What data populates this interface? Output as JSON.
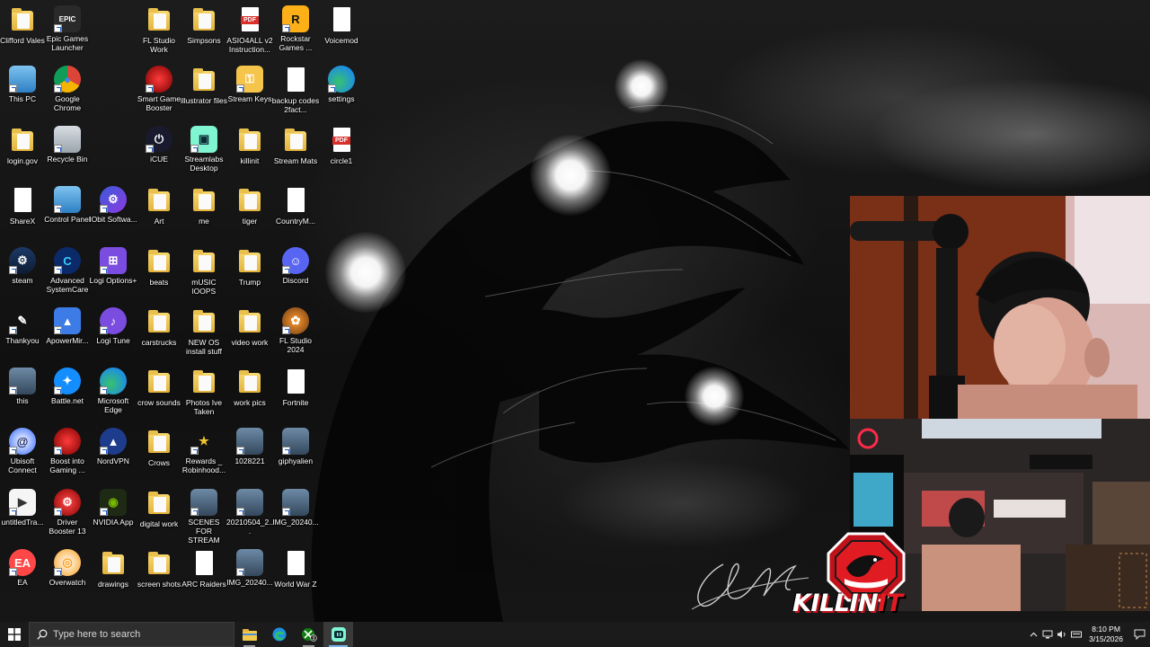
{
  "desktop": {
    "icons": [
      {
        "label": "Clifford Vales",
        "icon": "user-folder-icon"
      },
      {
        "label": "Epic Games Launcher",
        "icon": "epic-games-icon"
      },
      {
        "label": "FL Studio Work",
        "icon": "folder-icon"
      },
      {
        "label": "Simpsons",
        "icon": "folder-icon"
      },
      {
        "label": "ASIO4ALL v2 Instruction...",
        "icon": "pdf-icon"
      },
      {
        "label": "Rockstar Games ...",
        "icon": "rockstar-icon"
      },
      {
        "label": "Voicemod",
        "icon": "file-icon"
      },
      {
        "label": "This PC",
        "icon": "computer-icon"
      },
      {
        "label": "Google Chrome",
        "icon": "chrome-icon"
      },
      {
        "label": "Smart Game Booster",
        "icon": "game-booster-icon"
      },
      {
        "label": "illustrator files",
        "icon": "folder-icon"
      },
      {
        "label": "Stream Keys",
        "icon": "key-icon"
      },
      {
        "label": "backup codes 2fact...",
        "icon": "file-icon"
      },
      {
        "label": "settings",
        "icon": "edge-icon"
      },
      {
        "label": "login.gov",
        "icon": "folder-icon"
      },
      {
        "label": "Recycle Bin",
        "icon": "recycle-bin-icon"
      },
      {
        "label": "iCUE",
        "icon": "icue-icon"
      },
      {
        "label": "Streamlabs Desktop",
        "icon": "streamlabs-icon"
      },
      {
        "label": "killinit",
        "icon": "folder-icon"
      },
      {
        "label": "Stream Mats",
        "icon": "folder-icon"
      },
      {
        "label": "circle1",
        "icon": "pdf-icon"
      },
      {
        "label": "ShareX",
        "icon": "file-icon"
      },
      {
        "label": "Control Panel",
        "icon": "control-panel-icon"
      },
      {
        "label": "IObit Softwa...",
        "icon": "iobit-icon"
      },
      {
        "label": "Art",
        "icon": "folder-icon"
      },
      {
        "label": "me",
        "icon": "folder-icon"
      },
      {
        "label": "tiger",
        "icon": "folder-icon"
      },
      {
        "label": "CountryM...",
        "icon": "file-icon"
      },
      {
        "label": "steam",
        "icon": "steam-icon"
      },
      {
        "label": "Advanced SystemCare",
        "icon": "advanced-systemcare-icon"
      },
      {
        "label": "Logi Options+",
        "icon": "logi-options-icon"
      },
      {
        "label": "beats",
        "icon": "folder-icon"
      },
      {
        "label": "mUSIC lOOPS",
        "icon": "folder-icon"
      },
      {
        "label": "Trump",
        "icon": "folder-icon"
      },
      {
        "label": "Discord",
        "icon": "discord-icon"
      },
      {
        "label": "Thankyou",
        "icon": "thankyou-image-icon"
      },
      {
        "label": "ApowerMir...",
        "icon": "apowermirror-icon"
      },
      {
        "label": "Logi Tune",
        "icon": "logi-tune-icon"
      },
      {
        "label": "carstrucks",
        "icon": "folder-icon"
      },
      {
        "label": "NEW OS install stuff",
        "icon": "folder-icon"
      },
      {
        "label": "video work",
        "icon": "folder-icon"
      },
      {
        "label": "FL Studio 2024",
        "icon": "fl-studio-icon"
      },
      {
        "label": "this",
        "icon": "image-icon"
      },
      {
        "label": "Battle.net",
        "icon": "battlenet-icon"
      },
      {
        "label": "Microsoft Edge",
        "icon": "edge-icon"
      },
      {
        "label": "crow sounds",
        "icon": "folder-icon"
      },
      {
        "label": "Photos Ive Taken",
        "icon": "folder-icon"
      },
      {
        "label": "work pics",
        "icon": "folder-icon"
      },
      {
        "label": "Fortnite",
        "icon": "file-icon"
      },
      {
        "label": "Ubisoft Connect",
        "icon": "ubisoft-icon"
      },
      {
        "label": "Boost into Gaming ...",
        "icon": "game-booster-icon"
      },
      {
        "label": "NordVPN",
        "icon": "nordvpn-icon"
      },
      {
        "label": "Crows",
        "icon": "folder-icon"
      },
      {
        "label": "Rewards _ Robinhood...",
        "icon": "star-icon"
      },
      {
        "label": "1028221",
        "icon": "image-icon"
      },
      {
        "label": "giphyalien",
        "icon": "image-icon"
      },
      {
        "label": "untitledTra...",
        "icon": "video-icon"
      },
      {
        "label": "Driver Booster 13",
        "icon": "driver-booster-icon"
      },
      {
        "label": "NVIDIA App",
        "icon": "nvidia-icon"
      },
      {
        "label": "digital work",
        "icon": "folder-icon"
      },
      {
        "label": "SCENES FOR STREAM",
        "icon": "image-icon"
      },
      {
        "label": "20210504_2...",
        "icon": "image-icon"
      },
      {
        "label": "IMG_20240...",
        "icon": "image-icon"
      },
      {
        "label": "EA",
        "icon": "ea-icon"
      },
      {
        "label": "Overwatch",
        "icon": "overwatch-icon"
      },
      {
        "label": "drawings",
        "icon": "folder-icon"
      },
      {
        "label": "screen shots",
        "icon": "folder-icon"
      },
      {
        "label": "ARC Raiders",
        "icon": "file-icon"
      },
      {
        "label": "IMG_20240...",
        "icon": "image-icon"
      },
      {
        "label": "World War Z",
        "icon": "file-icon"
      }
    ]
  },
  "overlay": {
    "brand_main": "KILLIN",
    "brand_accent": "IT"
  },
  "taskbar": {
    "search_placeholder": "Type here to search",
    "apps": [
      {
        "name": "file-explorer",
        "icon": "folder-icon"
      },
      {
        "name": "microsoft-edge",
        "icon": "edge-icon"
      },
      {
        "name": "xbox",
        "icon": "xbox-icon",
        "badge": "3"
      },
      {
        "name": "streamlabs",
        "icon": "streamlabs-icon"
      }
    ],
    "time": "8:10 PM",
    "date": "3/15/2026"
  },
  "colors": {
    "taskbar_bg": "#1b1b1b",
    "accent_red": "#e11b22",
    "active_indicator": "#77b4ea"
  }
}
